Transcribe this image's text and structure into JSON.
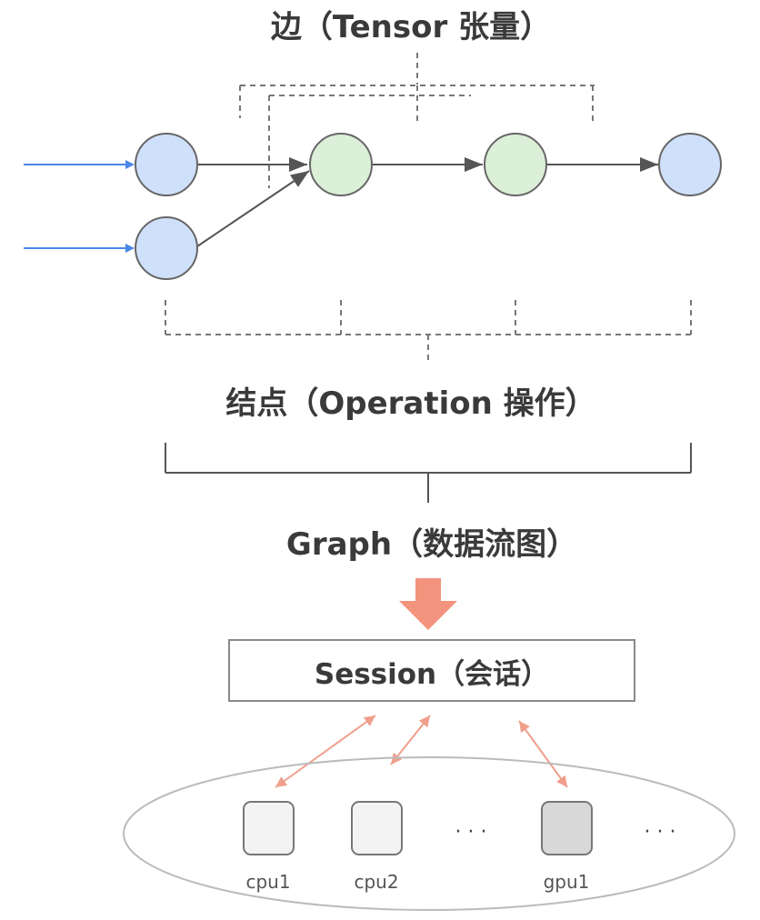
{
  "labels": {
    "edge_title": "边（Tensor 张量）",
    "node_title": "结点（Operation 操作）",
    "graph_title": "Graph（数据流图）",
    "session_title": "Session（会话）"
  },
  "devices": [
    {
      "label": "cpu1",
      "shade": "light"
    },
    {
      "label": "cpu2",
      "shade": "light"
    },
    {
      "label": "gpu1",
      "shade": "dark"
    }
  ],
  "ellipsis": "· · ·",
  "colors": {
    "blue_node_fill": "#cfe0fb",
    "green_node_fill": "#dcefd8",
    "node_stroke": "#666666",
    "input_arrow": "#4a86e8",
    "edge_arrow": "#555555",
    "dashed": "#777777",
    "big_arrow": "#f2937d",
    "session_arrows": "#ef9f8c",
    "device_light": "#f3f3f3",
    "device_dark": "#d8d8d8"
  }
}
